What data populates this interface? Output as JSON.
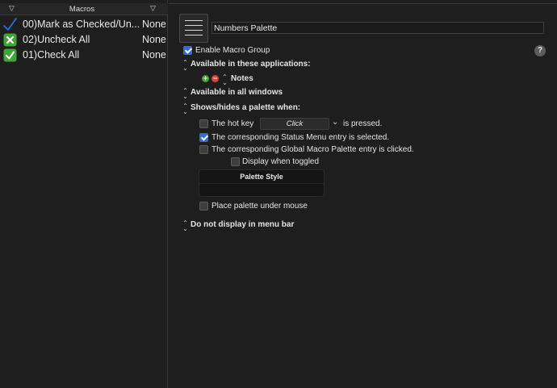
{
  "macro_list": {
    "header_title": "Macros",
    "sort_icon": "triangle-down-icon",
    "items": [
      {
        "name": "00)Mark as Checked/Un...",
        "trigger": "None",
        "icon": "checkmark-icon",
        "icon_color": "#2f6ed8"
      },
      {
        "name": "02)Uncheck All",
        "trigger": "None",
        "icon": "red-x-box-icon",
        "icon_color": "#3fa536"
      },
      {
        "name": "01)Check All",
        "trigger": "None",
        "icon": "green-check-box-icon",
        "icon_color": "#3fa536"
      }
    ]
  },
  "group": {
    "icon": "palette-lines-icon",
    "name": "Numbers Palette",
    "enable_label": "Enable Macro Group",
    "enable_checked": true,
    "help_label": "?"
  },
  "availability": {
    "apps_label": "Available in these applications:",
    "app_name": "Notes",
    "add_symbol": "+",
    "remove_symbol": "−",
    "windows_label": "Available in all windows"
  },
  "palette": {
    "shows_label": "Shows/hides a palette when:",
    "hotkey_label": "The hot key",
    "hotkey_value": "Click",
    "hotkey_suffix": "is pressed.",
    "hotkey_checked": false,
    "status_menu_label": "The corresponding Status Menu entry is selected.",
    "status_menu_checked": true,
    "global_palette_label": "The corresponding Global Macro Palette entry is clicked.",
    "global_palette_checked": false,
    "display_toggled_label": "Display when toggled",
    "display_toggled_checked": false,
    "style_title": "Palette Style",
    "under_mouse_label": "Place palette under mouse",
    "under_mouse_checked": false
  },
  "menu_bar_label": "Do not display in menu bar",
  "colors": {
    "accent": "#2f6ed8",
    "add": "#3fa536",
    "remove": "#d8453b",
    "background": "#1e1e1e"
  }
}
